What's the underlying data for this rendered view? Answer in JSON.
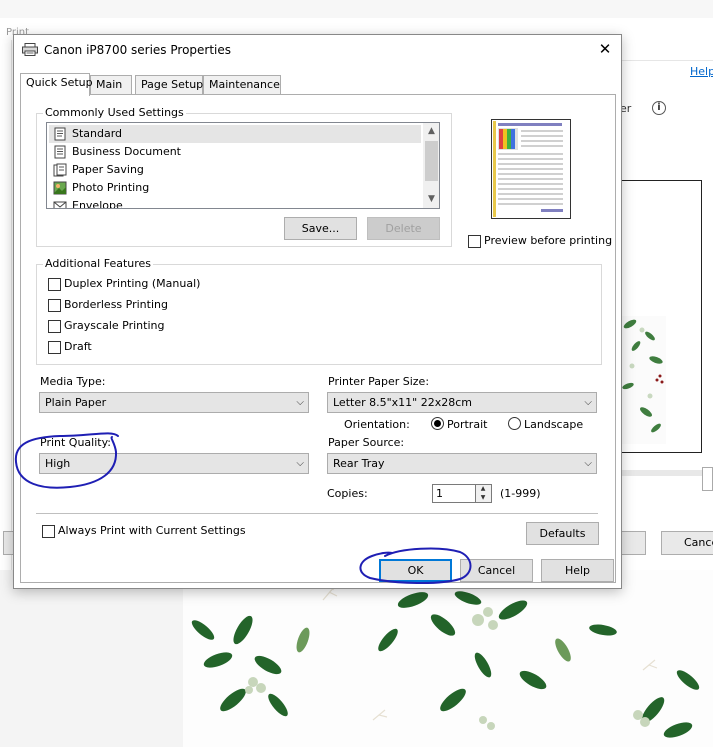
{
  "background_window": {
    "title": "Print",
    "help_link": "Help",
    "partial_label": "er",
    "info_icon": "info-icon",
    "cancel_label": "Cance"
  },
  "dialog": {
    "title": "Canon iP8700 series Properties",
    "printer_icon": "printer-icon",
    "close_icon": "close-icon"
  },
  "tabs": [
    {
      "label": "Quick Setup",
      "active": true
    },
    {
      "label": "Main",
      "active": false
    },
    {
      "label": "Page Setup",
      "active": false
    },
    {
      "label": "Maintenance",
      "active": false
    }
  ],
  "common_settings": {
    "label": "Commonly Used Settings",
    "items": [
      {
        "label": "Standard",
        "icon": "standard-icon",
        "selected": true
      },
      {
        "label": "Business Document",
        "icon": "document-icon",
        "selected": false
      },
      {
        "label": "Paper Saving",
        "icon": "paper-saving-icon",
        "selected": false
      },
      {
        "label": "Photo Printing",
        "icon": "photo-icon",
        "selected": false
      },
      {
        "label": "Envelope",
        "icon": "envelope-icon",
        "selected": false
      }
    ],
    "save_button": "Save...",
    "delete_button": "Delete"
  },
  "preview": {
    "checkbox_label": "Preview before printing",
    "checked": false
  },
  "additional_features": {
    "label": "Additional Features",
    "items": [
      {
        "label": "Duplex Printing (Manual)",
        "checked": false
      },
      {
        "label": "Borderless Printing",
        "checked": false
      },
      {
        "label": "Grayscale Printing",
        "checked": false
      },
      {
        "label": "Draft",
        "checked": false
      }
    ]
  },
  "media_type": {
    "label": "Media Type:",
    "value": "Plain Paper"
  },
  "paper_size": {
    "label": "Printer Paper Size:",
    "value": "Letter 8.5\"x11\" 22x28cm"
  },
  "orientation": {
    "label": "Orientation:",
    "portrait": "Portrait",
    "landscape": "Landscape",
    "selected": "Portrait"
  },
  "print_quality": {
    "label": "Print Quality:",
    "value": "High"
  },
  "paper_source": {
    "label": "Paper Source:",
    "value": "Rear Tray"
  },
  "copies": {
    "label": "Copies:",
    "value": "1",
    "range": "(1-999)"
  },
  "always_print": {
    "label": "Always Print with Current Settings",
    "checked": false
  },
  "defaults_button": "Defaults",
  "footer": {
    "ok": "OK",
    "cancel": "Cancel",
    "help": "Help"
  },
  "colors": {
    "accent": "#0078d7",
    "annotation": "#1f1fb4",
    "leaf": "#2e7d32"
  }
}
